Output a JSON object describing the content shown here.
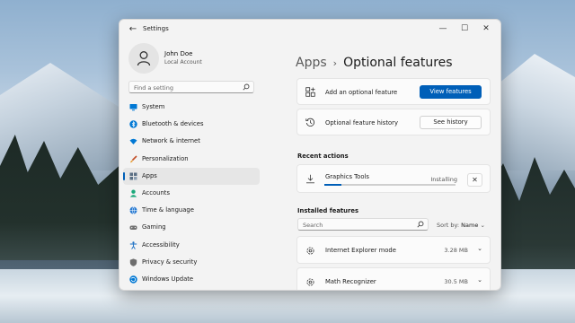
{
  "window": {
    "title": "Settings"
  },
  "profile": {
    "name": "John Doe",
    "account": "Local Account"
  },
  "sidebar": {
    "search_placeholder": "Find a setting",
    "items": [
      {
        "label": "System",
        "icon": "monitor-icon",
        "color": "#0078d4"
      },
      {
        "label": "Bluetooth & devices",
        "icon": "bluetooth-icon",
        "color": "#0078d4"
      },
      {
        "label": "Network & internet",
        "icon": "wifi-icon",
        "color": "#0078d4"
      },
      {
        "label": "Personalization",
        "icon": "brush-icon",
        "color": "#c24f28"
      },
      {
        "label": "Apps",
        "icon": "apps-icon",
        "color": "#5a6f84",
        "active": true
      },
      {
        "label": "Accounts",
        "icon": "person-icon",
        "color": "#1aa87a"
      },
      {
        "label": "Time & language",
        "icon": "globe-icon",
        "color": "#2b7cd3"
      },
      {
        "label": "Gaming",
        "icon": "controller-icon",
        "color": "#707070"
      },
      {
        "label": "Accessibility",
        "icon": "accessibility-icon",
        "color": "#1a6fc4"
      },
      {
        "label": "Privacy & security",
        "icon": "shield-icon",
        "color": "#6d6d6d"
      },
      {
        "label": "Windows Update",
        "icon": "update-icon",
        "color": "#0078d4"
      }
    ]
  },
  "breadcrumb": {
    "parent": "Apps",
    "separator": "›",
    "current": "Optional features"
  },
  "add_feature": {
    "label": "Add an optional feature",
    "button": "View features"
  },
  "history": {
    "label": "Optional feature history",
    "button": "See history"
  },
  "recent": {
    "heading": "Recent actions",
    "item": {
      "name": "Graphics Tools",
      "status": "Installing",
      "progress": 0.13,
      "cancel": "✕"
    }
  },
  "installed": {
    "heading": "Installed features",
    "search_placeholder": "Search",
    "sort_label": "Sort by:",
    "sort_value": "Name",
    "items": [
      {
        "name": "Internet Explorer mode",
        "size": "3.28 MB"
      },
      {
        "name": "Math Recognizer",
        "size": "30.5 MB"
      }
    ]
  },
  "colors": {
    "accent": "#005fb8",
    "window_bg": "#f3f3f3"
  }
}
